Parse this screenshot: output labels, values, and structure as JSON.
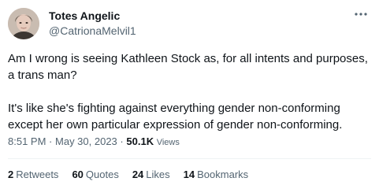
{
  "author": {
    "name": "Totes Angelic",
    "handle": "@CatrionaMelvil1",
    "avatar_icon": "profile-photo"
  },
  "tweet": {
    "paragraphs": [
      "Am I wrong is seeing Kathleen Stock as, for all intents and purposes, a trans man?",
      "It's like she's fighting against everything gender non-conforming except her own particular expression of gender non-conforming."
    ]
  },
  "meta": {
    "time": "8:51 PM",
    "separator1": "·",
    "date": "May 30, 2023",
    "separator2": "·",
    "views_count": "50.1K",
    "views_label": "Views"
  },
  "stats": {
    "retweets": {
      "count": "2",
      "label": "Retweets"
    },
    "quotes": {
      "count": "60",
      "label": "Quotes"
    },
    "likes": {
      "count": "24",
      "label": "Likes"
    },
    "bookmarks": {
      "count": "14",
      "label": "Bookmarks"
    }
  },
  "colors": {
    "text_primary": "#0f1419",
    "text_secondary": "#536471",
    "divider": "#eff3f4"
  },
  "icons": {
    "more": "more-horizontal-icon"
  }
}
